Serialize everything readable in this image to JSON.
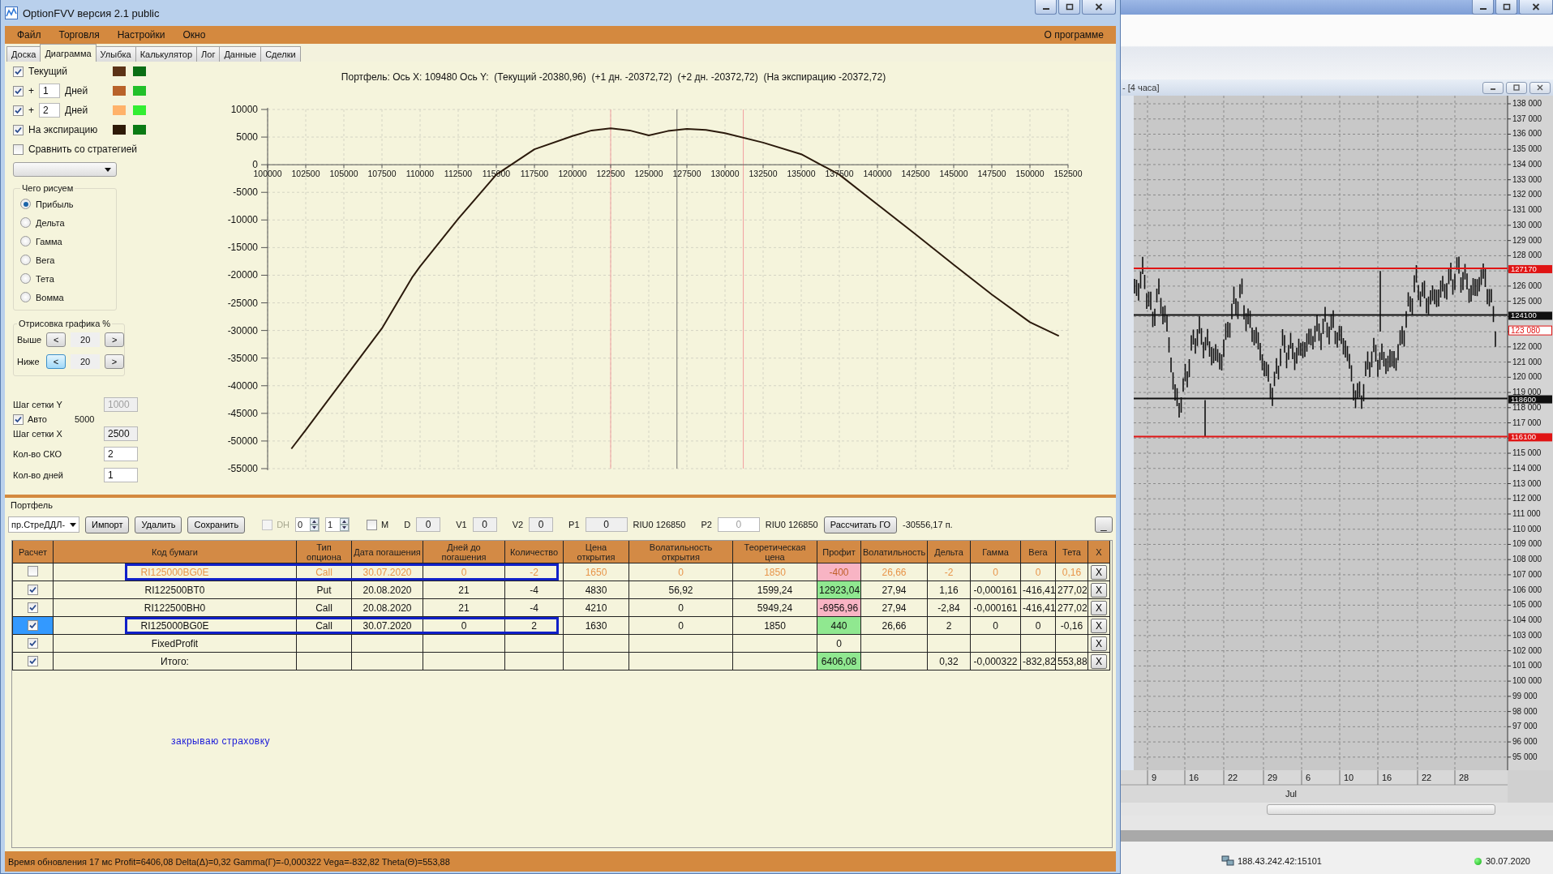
{
  "window": {
    "title": "OptionFVV версия 2.1 public"
  },
  "menu": {
    "items": [
      "Файл",
      "Торговля",
      "Настройки",
      "Окно"
    ],
    "right_item": "О программе"
  },
  "tabs": [
    {
      "label": "Доска",
      "selected": false
    },
    {
      "label": "Диаграмма",
      "selected": true
    },
    {
      "label": "Улыбка",
      "selected": false
    },
    {
      "label": "Калькулятор",
      "selected": false
    },
    {
      "label": "Лог",
      "selected": false
    },
    {
      "label": "Данные",
      "selected": false
    },
    {
      "label": "Сделки",
      "selected": false
    }
  ],
  "legend": [
    {
      "kind": "series",
      "checked": true,
      "label": "Текущий",
      "swatches": [
        {
          "color": "#5c3317"
        },
        {
          "color": "#0a6e14"
        }
      ]
    },
    {
      "kind": "offset",
      "checked": true,
      "sign": "+",
      "days": "1",
      "unit": "Дней",
      "swatches": [
        {
          "color": "#b8622a"
        },
        {
          "color": "#22c02a"
        }
      ]
    },
    {
      "kind": "offset",
      "checked": true,
      "sign": "+",
      "days": "2",
      "unit": "Дней",
      "swatches": [
        {
          "color": "#ffb26a"
        },
        {
          "color": "#33ee33"
        }
      ]
    },
    {
      "kind": "series",
      "checked": true,
      "label": "На экспирацию",
      "swatches": [
        {
          "color": "#2e1a08"
        },
        {
          "color": "#0a7a14"
        }
      ]
    }
  ],
  "compare": {
    "label": "Сравнить со стратегией",
    "checked": false
  },
  "draw_group": {
    "title": "Чего рисуем",
    "options": [
      {
        "label": "Прибыль",
        "selected": true
      },
      {
        "label": "Дельта",
        "selected": false
      },
      {
        "label": "Гамма",
        "selected": false
      },
      {
        "label": "Вега",
        "selected": false
      },
      {
        "label": "Тета",
        "selected": false
      },
      {
        "label": "Вомма",
        "selected": false
      }
    ]
  },
  "range_group": {
    "title": "Отрисовка графика %",
    "rows": [
      {
        "label": "Выше",
        "dec": "<",
        "value": "20",
        "inc": ">",
        "dec_highlighted": false
      },
      {
        "label": "Ниже",
        "dec": "<",
        "value": "20",
        "inc": ">",
        "dec_highlighted": true
      }
    ]
  },
  "grid_settings": [
    {
      "kind": "field",
      "label": "Шаг сетки Y",
      "value": "1000",
      "disabled": true,
      "readonly": true
    },
    {
      "kind": "check",
      "label": "Авто",
      "checked": true,
      "value": "5000"
    },
    {
      "kind": "field",
      "label": "Шаг сетки X",
      "value": "2500",
      "disabled": false,
      "readonly": true
    },
    {
      "kind": "field",
      "label": "Кол-во СКО",
      "value": "2",
      "disabled": false,
      "readonly": false
    },
    {
      "kind": "field",
      "label": "Кол-во дней",
      "value": "1",
      "disabled": false,
      "readonly": false
    }
  ],
  "chart": {
    "chart_data": {
      "type": "line",
      "title": "Портфель: Ось X: 109480 Ось Y:  (Текущий -20380,96)  (+1 дн. -20372,72)  (+2 дн. -20372,72)  (На экспирацию -20372,72)",
      "x": [
        101560,
        102500,
        105000,
        107500,
        109480,
        110000,
        112500,
        115000,
        117500,
        120000,
        121250,
        122500,
        123750,
        125000,
        126250,
        127500,
        128750,
        130000,
        132500,
        135000,
        137500,
        140000,
        142500,
        145000,
        147500,
        150000,
        151900
      ],
      "series": [
        {
          "color": "#2b1a0c",
          "values": [
            -51400,
            -48000,
            -38800,
            -29600,
            -20400,
            -18400,
            -9800,
            -1800,
            2800,
            5200,
            6200,
            6600,
            6200,
            5300,
            6100,
            6500,
            6300,
            5700,
            4000,
            1900,
            -1800,
            -7200,
            -12600,
            -18100,
            -23500,
            -28500,
            -31000
          ]
        }
      ],
      "xlim": [
        100000,
        152500
      ],
      "ylim": [
        -55000,
        10000
      ],
      "xticks": [
        100000,
        102500,
        105000,
        107500,
        110000,
        112500,
        115000,
        117500,
        120000,
        122500,
        125000,
        127500,
        130000,
        132500,
        135000,
        137500,
        140000,
        142500,
        145000,
        147500,
        150000,
        152500
      ],
      "yticks": [
        10000,
        5000,
        0,
        -5000,
        -10000,
        -15000,
        -20000,
        -25000,
        -30000,
        -35000,
        -40000,
        -45000,
        -50000,
        -55000
      ],
      "grid": true,
      "ref_lines": [
        {
          "axis": "x",
          "value": 122500,
          "color": "#f2a0a0"
        },
        {
          "axis": "x",
          "value": 126850,
          "color": "#707070"
        },
        {
          "axis": "x",
          "value": 131200,
          "color": "#f2a0a0"
        }
      ]
    }
  },
  "portfolio": {
    "title": "Портфель",
    "toolbar": [
      {
        "kind": "select",
        "value": "пр.СтреДДЛ-"
      },
      {
        "kind": "button",
        "label": "Импорт"
      },
      {
        "kind": "button",
        "label": "Удалить"
      },
      {
        "kind": "button",
        "label": "Сохранить"
      },
      {
        "kind": "check",
        "label": "DH",
        "checked": false,
        "disabled": true
      },
      {
        "kind": "spin",
        "value": "0"
      },
      {
        "kind": "spin",
        "value": "1"
      },
      {
        "kind": "check",
        "label": "M",
        "checked": false,
        "disabled": false
      },
      {
        "kind": "field",
        "label": "D",
        "value": "0",
        "disabled": false
      },
      {
        "kind": "field",
        "label": "V1",
        "value": "0",
        "disabled": false
      },
      {
        "kind": "field",
        "label": "V2",
        "value": "0",
        "disabled": false
      },
      {
        "kind": "field",
        "label": "P1",
        "value": "0",
        "disabled": false
      },
      {
        "kind": "text",
        "text": "RIU0 126850"
      },
      {
        "kind": "field",
        "label": "P2",
        "value": "0",
        "disabled": true
      },
      {
        "kind": "text",
        "text": "RIU0 126850"
      },
      {
        "kind": "button",
        "label": "Рассчитать ГО"
      },
      {
        "kind": "text",
        "text": "-30556,17 п."
      }
    ],
    "collapse_button": "_",
    "table": {
      "columns": [
        "Расчет",
        "Код бумаги",
        "Тип опциона",
        "Дата погашения",
        "Дней до погашения",
        "Количество",
        "Цена открытия",
        "Волатильность открытия",
        "Теоретическая цена",
        "Профит",
        "Волатильность",
        "Дельта",
        "Гамма",
        "Вега",
        "Тета",
        "X"
      ],
      "rows": [
        {
          "calc": false,
          "selected": false,
          "disabled": true,
          "outlined": true,
          "color": "#f8b4c4",
          "cells": [
            "",
            "RI125000BG0E",
            "Call",
            "30.07.2020",
            "0",
            "-2",
            "1650",
            "0",
            "1850",
            "-400",
            "26,66",
            "-2",
            "0",
            "0",
            "0,16",
            "X"
          ]
        },
        {
          "calc": true,
          "selected": false,
          "disabled": false,
          "outlined": false,
          "color": "#90e890",
          "cells": [
            "",
            "RI122500BT0",
            "Put",
            "20.08.2020",
            "21",
            "-4",
            "4830",
            "56,92",
            "1599,24",
            "12923,04",
            "27,94",
            "1,16",
            "-0,000161",
            "-416,41",
            "277,02",
            "X"
          ]
        },
        {
          "calc": true,
          "selected": false,
          "disabled": false,
          "outlined": false,
          "color": "#f8b4c4",
          "cells": [
            "",
            "RI122500BH0",
            "Call",
            "20.08.2020",
            "21",
            "-4",
            "4210",
            "0",
            "5949,24",
            "-6956,96",
            "27,94",
            "-2,84",
            "-0,000161",
            "-416,41",
            "277,02",
            "X"
          ]
        },
        {
          "calc": true,
          "selected": true,
          "disabled": false,
          "outlined": true,
          "color": "#90e890",
          "cells": [
            "",
            "RI125000BG0E",
            "Call",
            "30.07.2020",
            "0",
            "2",
            "1630",
            "0",
            "1850",
            "440",
            "26,66",
            "2",
            "0",
            "0",
            "-0,16",
            "X"
          ]
        },
        {
          "calc": true,
          "selected": false,
          "disabled": false,
          "outlined": false,
          "cells": [
            "",
            "FixedProfit",
            "",
            "",
            "",
            "",
            "",
            "",
            "",
            "0",
            "",
            "",
            "",
            "",
            "",
            "X"
          ]
        },
        {
          "calc": true,
          "selected": false,
          "disabled": false,
          "outlined": false,
          "color": "#90e890",
          "cells": [
            "",
            "Итого:",
            "",
            "",
            "",
            "",
            "",
            "",
            "",
            "6406,08",
            "",
            "0,32",
            "-0,000322",
            "-832,82",
            "553,88",
            "X"
          ]
        }
      ]
    },
    "note": "закрываю страховку"
  },
  "status_bar": "Время обновления 17 мс  Profit=6406,08 Delta(Δ)=0,32 Gamma(Г)=-0,000322 Vega=-832,82 Theta(Θ)=553,88",
  "background_window": {
    "title": "- [4 часа]",
    "price_axis": [
      "138 000",
      "137 000",
      "136 000",
      "135 000",
      "134 000",
      "133 000",
      "132 000",
      "131 000",
      "130 000",
      "129 000",
      "128 000",
      "126 000",
      "125 000",
      "122 000",
      "121 000",
      "120 000",
      "119 000",
      "118 000",
      "117 000",
      "115 000",
      "114 000",
      "113 000",
      "112 000",
      "111 000",
      "110 000",
      "109 000",
      "108 000",
      "107 000",
      "106 000",
      "105 000",
      "104 000",
      "103 000",
      "102 000",
      "101 000",
      "100 000",
      "99 000",
      "98 000",
      "97 000",
      "96 000",
      "95 000"
    ],
    "levels": [
      {
        "kind": "line",
        "label": "127170",
        "color": "#e01414"
      },
      {
        "kind": "line",
        "label": "124100",
        "color": "#101010"
      },
      {
        "kind": "marker",
        "label": "123 080",
        "color": "#e01414"
      },
      {
        "kind": "line",
        "label": "118600",
        "color": "#101010"
      },
      {
        "kind": "line",
        "label": "116100",
        "color": "#e01414"
      }
    ],
    "time_labels": [
      "9",
      "16",
      "22",
      "29",
      "6",
      "10",
      "16",
      "22",
      "28"
    ],
    "month_label": "Jul"
  },
  "background_status": {
    "connection": "188.43.242.42:15101",
    "date": "30.07.2020"
  }
}
